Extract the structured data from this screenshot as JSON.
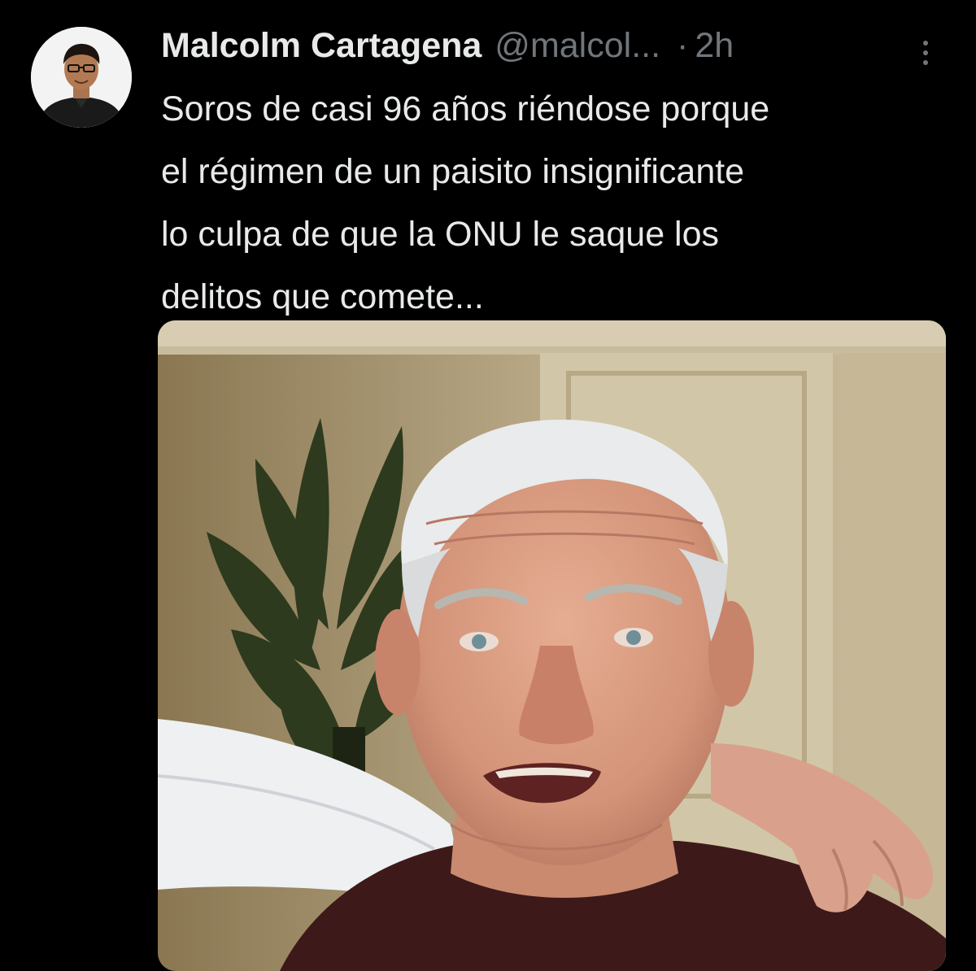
{
  "tweet": {
    "author": {
      "display_name": "Malcolm Cartagena",
      "handle": "@malcol...",
      "avatar_icon": "user-avatar-photo"
    },
    "separator": "·",
    "timestamp": "2h",
    "more_icon": "more-vertical-icon",
    "text_lines": [
      "Soros de casi 96 años riéndose porque",
      "el régimen de un paisito insignificante",
      "lo culpa de que la ONU le saque los",
      "delitos que comete..."
    ],
    "media": {
      "type": "photo"
    }
  },
  "colors": {
    "background": "#000000",
    "primary_text": "#e7e9ea",
    "secondary_text": "#71767b"
  }
}
